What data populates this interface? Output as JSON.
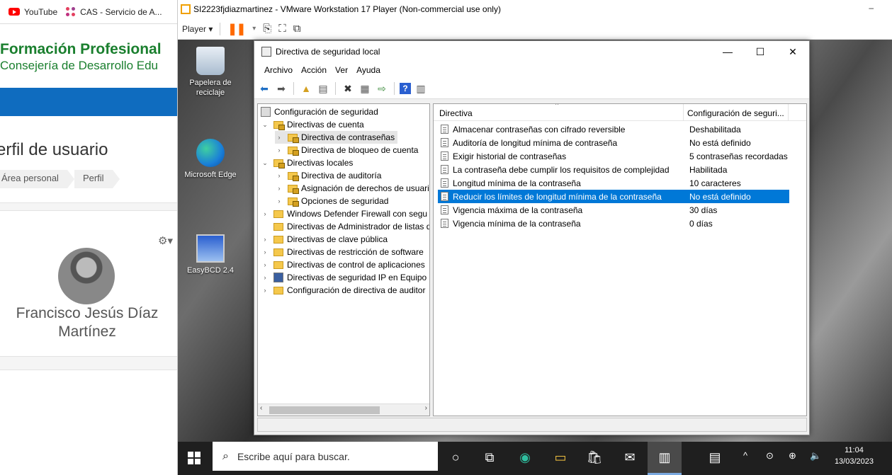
{
  "browser": {
    "bookmarks": [
      {
        "label": "YouTube",
        "icon": "youtube-icon"
      },
      {
        "label": "CAS - Servicio de A...",
        "icon": "cas-icon"
      }
    ],
    "brand_line1": "Formación Profesional",
    "brand_line2": "Consejería de Desarrollo Edu",
    "page_title": "erfil de usuario",
    "breadcrumbs": [
      "Área personal",
      "Perfil"
    ],
    "user_name": "Francisco Jesús Díaz Martínez"
  },
  "vmware": {
    "title": "SI2223fjdiazmartinez - VMware Workstation 17 Player (Non-commercial use only)",
    "player_menu": "Player",
    "minimize_label": "–"
  },
  "desktop_icons": [
    {
      "label": "Papelera de reciclaje",
      "icon": "recycle-bin-icon"
    },
    {
      "label": "Microsoft Edge",
      "icon": "edge-icon"
    },
    {
      "label": "EasyBCD 2.4",
      "icon": "easybcd-icon"
    }
  ],
  "mmc": {
    "title": "Directiva de seguridad local",
    "window_buttons": {
      "minimize": "—",
      "maximize": "☐",
      "close": "✕"
    },
    "menu": [
      "Archivo",
      "Acción",
      "Ver",
      "Ayuda"
    ],
    "tree": [
      {
        "label": "Configuración de seguridad",
        "level": 0,
        "arrow": "",
        "icon": "shield"
      },
      {
        "label": "Directivas de cuenta",
        "level": 1,
        "arrow": "⌄",
        "icon": "folder-lock"
      },
      {
        "label": "Directiva de contraseñas",
        "level": 2,
        "arrow": "›",
        "icon": "folder-lock",
        "selected": true
      },
      {
        "label": "Directiva de bloqueo de cuenta",
        "level": 2,
        "arrow": "›",
        "icon": "folder-lock"
      },
      {
        "label": "Directivas locales",
        "level": 1,
        "arrow": "⌄",
        "icon": "folder-lock"
      },
      {
        "label": "Directiva de auditoría",
        "level": 2,
        "arrow": "›",
        "icon": "folder-lock"
      },
      {
        "label": "Asignación de derechos de usuari",
        "level": 2,
        "arrow": "›",
        "icon": "folder-lock"
      },
      {
        "label": "Opciones de seguridad",
        "level": 2,
        "arrow": "›",
        "icon": "folder-lock"
      },
      {
        "label": "Windows Defender Firewall con segu",
        "level": 1,
        "arrow": "›",
        "icon": "folder"
      },
      {
        "label": "Directivas de Administrador de listas d",
        "level": 1,
        "arrow": "",
        "icon": "folder"
      },
      {
        "label": "Directivas de clave pública",
        "level": 1,
        "arrow": "›",
        "icon": "folder"
      },
      {
        "label": "Directivas de restricción de software",
        "level": 1,
        "arrow": "›",
        "icon": "folder"
      },
      {
        "label": "Directivas de control de aplicaciones",
        "level": 1,
        "arrow": "›",
        "icon": "folder"
      },
      {
        "label": "Directivas de seguridad IP en Equipo l",
        "level": 1,
        "arrow": "›",
        "icon": "ipsec"
      },
      {
        "label": "Configuración de directiva de auditor",
        "level": 1,
        "arrow": "›",
        "icon": "folder"
      }
    ],
    "list_headers": [
      "Directiva",
      "Configuración de seguri..."
    ],
    "rows": [
      {
        "policy": "Almacenar contraseñas con cifrado reversible",
        "setting": "Deshabilitada"
      },
      {
        "policy": "Auditoría de longitud mínima de contraseña",
        "setting": "No está definido"
      },
      {
        "policy": "Exigir historial de contraseñas",
        "setting": "5 contraseñas recordadas"
      },
      {
        "policy": "La contraseña debe cumplir los requisitos de complejidad",
        "setting": "Habilitada"
      },
      {
        "policy": "Longitud mínima de la contraseña",
        "setting": "10 caracteres"
      },
      {
        "policy": "Reducir los límites de longitud mínima de la contraseña",
        "setting": "No está definido",
        "selected": true
      },
      {
        "policy": "Vigencia máxima de la contraseña",
        "setting": "30 días"
      },
      {
        "policy": "Vigencia mínima de la contraseña",
        "setting": "0 días"
      }
    ]
  },
  "taskbar": {
    "search_placeholder": "Escribe aquí para buscar.",
    "time": "11:04",
    "date": "13/03/2023"
  },
  "colors": {
    "selection": "#0078d7",
    "brand_green": "#1a7f2e",
    "brand_blue": "#0f6cbf",
    "taskbar": "#1f1f1f",
    "vmware_pause": "#ff6a00"
  }
}
